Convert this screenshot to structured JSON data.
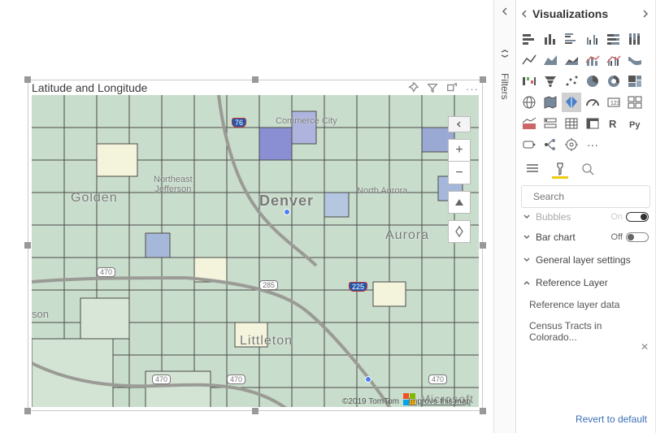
{
  "visual": {
    "title": "Latitude and Longitude",
    "attribution_prefix": "©2019 TomTom",
    "attribution_link": "Improve this map",
    "ms_brand": "Microsoft",
    "labels": {
      "denver": "Denver",
      "aurora": "Aurora",
      "golden": "Golden",
      "littleton": "Littleton",
      "nj": "Northeast\nJefferson",
      "commerce": "Commerce City",
      "naurora": "North Aurora",
      "son": "son"
    },
    "shields": {
      "i76": "76",
      "i225": "225",
      "c470a": "470",
      "c470b": "470",
      "c470c": "470",
      "c470d": "470",
      "us285": "285"
    }
  },
  "filters": {
    "label": "Filters"
  },
  "pane": {
    "title": "Visualizations",
    "search_placeholder": "Search",
    "sections": {
      "bubbles": "Bubbles",
      "barchart": "Bar chart",
      "general": "General layer settings",
      "reflayer": "Reference Layer",
      "refdata": "Reference layer data",
      "refname": "Census Tracts in Colorado...",
      "off": "Off"
    },
    "revert": "Revert to default"
  }
}
